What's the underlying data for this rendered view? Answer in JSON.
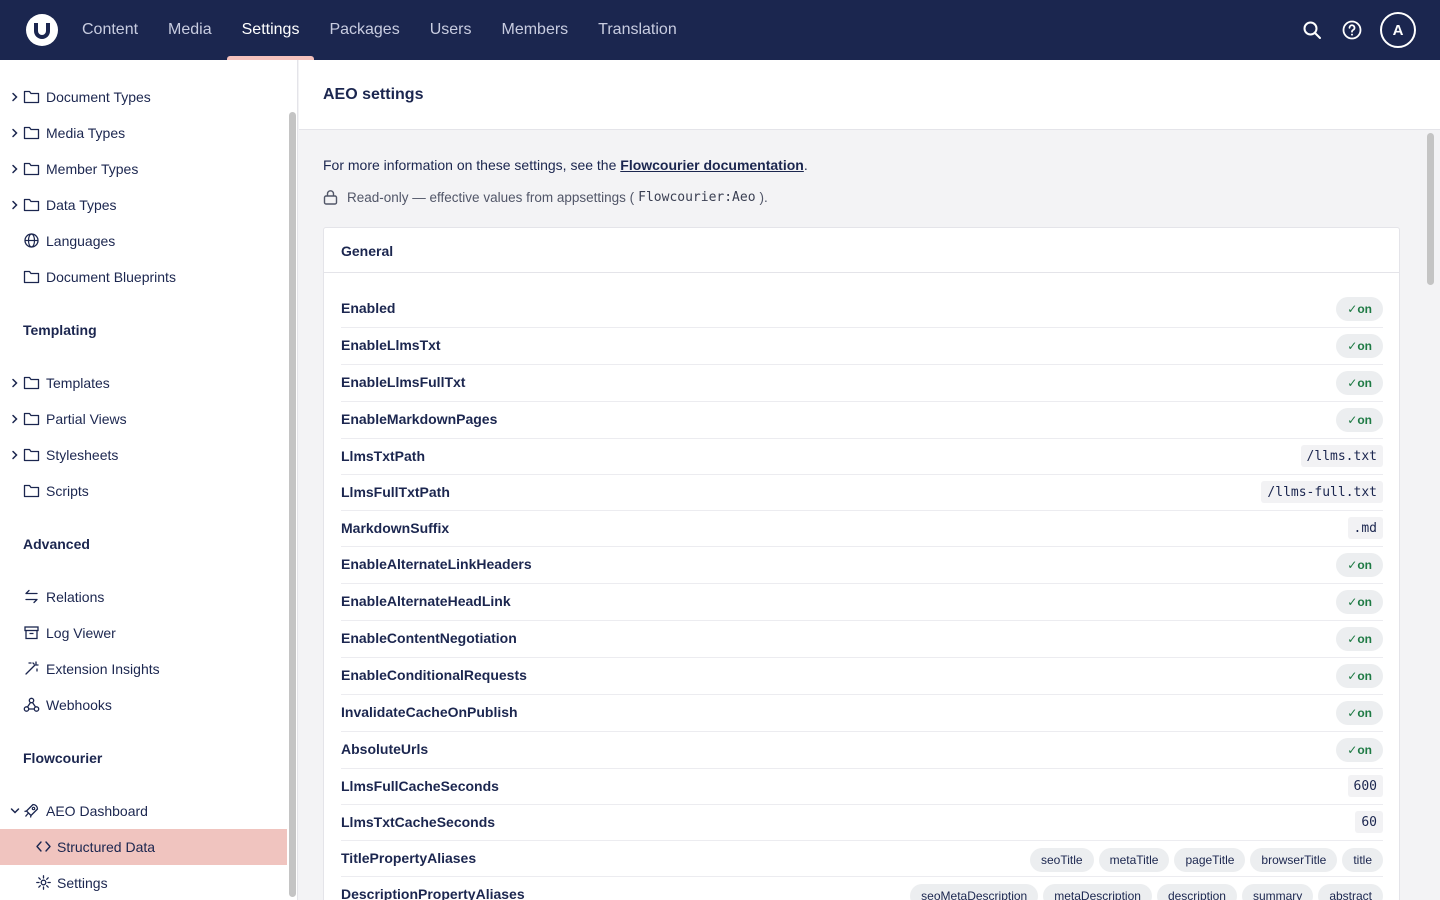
{
  "topnav": {
    "items": [
      {
        "label": "Content"
      },
      {
        "label": "Media"
      },
      {
        "label": "Settings"
      },
      {
        "label": "Packages"
      },
      {
        "label": "Users"
      },
      {
        "label": "Members"
      },
      {
        "label": "Translation"
      }
    ],
    "active": "Settings",
    "avatar_initial": "A",
    "icons": [
      "search-icon",
      "help-icon"
    ]
  },
  "sidebar": {
    "structure_items": [
      {
        "label": "Document Types",
        "icon": "folder-icon",
        "expandable": true
      },
      {
        "label": "Media Types",
        "icon": "folder-icon",
        "expandable": true
      },
      {
        "label": "Member Types",
        "icon": "folder-icon",
        "expandable": true
      },
      {
        "label": "Data Types",
        "icon": "folder-icon",
        "expandable": true
      },
      {
        "label": "Languages",
        "icon": "globe-icon",
        "expandable": false
      },
      {
        "label": "Document Blueprints",
        "icon": "folder-icon",
        "expandable": false
      }
    ],
    "templating": {
      "heading": "Templating",
      "items": [
        {
          "label": "Templates",
          "icon": "folder-icon",
          "expandable": true
        },
        {
          "label": "Partial Views",
          "icon": "folder-icon",
          "expandable": true
        },
        {
          "label": "Stylesheets",
          "icon": "folder-icon",
          "expandable": true
        },
        {
          "label": "Scripts",
          "icon": "folder-icon",
          "expandable": false
        }
      ]
    },
    "advanced": {
      "heading": "Advanced",
      "items": [
        {
          "label": "Relations",
          "icon": "arrows-icon"
        },
        {
          "label": "Log Viewer",
          "icon": "archive-icon"
        },
        {
          "label": "Extension Insights",
          "icon": "wand-icon"
        },
        {
          "label": "Webhooks",
          "icon": "webhook-icon"
        }
      ]
    },
    "flowcourier": {
      "heading": "Flowcourier",
      "items": [
        {
          "label": "AEO Dashboard",
          "icon": "rocket-icon",
          "expanded": true
        },
        {
          "label": "Structured Data",
          "icon": "code-icon",
          "selected": true
        },
        {
          "label": "Settings",
          "icon": "gear-icon"
        }
      ]
    }
  },
  "main": {
    "title": "AEO settings",
    "info_prefix": "For more information on these settings, see the ",
    "info_link": "Flowcourier documentation",
    "info_suffix": ".",
    "readonly_prefix": "Read-only — effective values from appsettings (",
    "readonly_code": "Flowcourier:Aeo",
    "readonly_suffix": ").",
    "section": {
      "title": "General",
      "rows": [
        {
          "key": "Enabled",
          "type": "bool",
          "value": "✓on"
        },
        {
          "key": "EnableLlmsTxt",
          "type": "bool",
          "value": "✓on"
        },
        {
          "key": "EnableLlmsFullTxt",
          "type": "bool",
          "value": "✓on"
        },
        {
          "key": "EnableMarkdownPages",
          "type": "bool",
          "value": "✓on"
        },
        {
          "key": "LlmsTxtPath",
          "type": "code",
          "value": "/llms.txt"
        },
        {
          "key": "LlmsFullTxtPath",
          "type": "code",
          "value": "/llms-full.txt"
        },
        {
          "key": "MarkdownSuffix",
          "type": "code",
          "value": ".md"
        },
        {
          "key": "EnableAlternateLinkHeaders",
          "type": "bool",
          "value": "✓on"
        },
        {
          "key": "EnableAlternateHeadLink",
          "type": "bool",
          "value": "✓on"
        },
        {
          "key": "EnableContentNegotiation",
          "type": "bool",
          "value": "✓on"
        },
        {
          "key": "EnableConditionalRequests",
          "type": "bool",
          "value": "✓on"
        },
        {
          "key": "InvalidateCacheOnPublish",
          "type": "bool",
          "value": "✓on"
        },
        {
          "key": "AbsoluteUrls",
          "type": "bool",
          "value": "✓on"
        },
        {
          "key": "LlmsFullCacheSeconds",
          "type": "code",
          "value": "600"
        },
        {
          "key": "LlmsTxtCacheSeconds",
          "type": "code",
          "value": "60"
        },
        {
          "key": "TitlePropertyAliases",
          "type": "tags",
          "tags": [
            "seoTitle",
            "metaTitle",
            "pageTitle",
            "browserTitle",
            "title"
          ]
        },
        {
          "key": "DescriptionPropertyAliases",
          "type": "tags",
          "tags": [
            "seoMetaDescription",
            "metaDescription",
            "description",
            "summary",
            "abstract"
          ]
        }
      ]
    }
  },
  "colors": {
    "topbar": "#1b264f",
    "active_underline": "#f5c1bc",
    "selected_item": "#f0c4bf",
    "on_green": "#1e7a44"
  }
}
